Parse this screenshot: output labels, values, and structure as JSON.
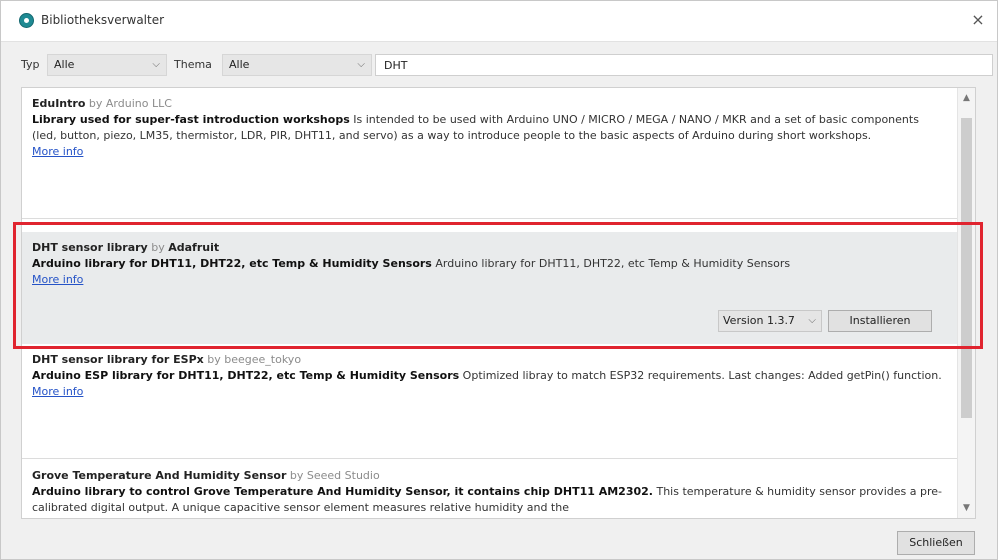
{
  "window": {
    "title": "Bibliotheksverwalter",
    "close_glyph": "×"
  },
  "filters": {
    "type_label": "Typ",
    "type_value": "Alle",
    "topic_label": "Thema",
    "topic_value": "Alle",
    "search_value": "DHT",
    "chevron": "⌵"
  },
  "libraries": [
    {
      "name": "EduIntro",
      "by": "by",
      "author": "Arduino LLC",
      "summary": "Library used for super-fast introduction workshops",
      "description": " Is intended to be used with Arduino UNO / MICRO / MEGA / NANO / MKR and a set of basic components (led, button, piezo, LM35, thermistor, LDR, PIR, DHT11, and servo) as a way to introduce people to the basic aspects of Arduino during short workshops.",
      "more_info": "More info"
    },
    {
      "name": "DHT sensor library",
      "by": "by",
      "author": "Adafruit",
      "summary": "Arduino library for DHT11, DHT22, etc Temp & Humidity Sensors",
      "description": " Arduino library for DHT11, DHT22, etc Temp & Humidity Sensors",
      "more_info": "More info",
      "version_label": "Version 1.3.7",
      "install_label": "Installieren"
    },
    {
      "name": "DHT sensor library for ESPx",
      "by": "by",
      "author": "beegee_tokyo",
      "summary": "Arduino ESP library for DHT11, DHT22, etc Temp & Humidity Sensors",
      "description": " Optimized libray to match ESP32 requirements. Last changes: Added getPin() function.",
      "more_info": "More info"
    },
    {
      "name": "Grove Temperature And Humidity Sensor",
      "by": "by",
      "author": "Seeed Studio",
      "summary": "Arduino library to control Grove Temperature And Humidity Sensor, it contains chip DHT11 AM2302.",
      "description": " This temperature & humidity sensor provides a pre-calibrated digital output. A unique capacitive sensor element measures relative humidity and the"
    }
  ],
  "scroll": {
    "up": "▲",
    "down": "▼"
  },
  "footer": {
    "close_label": "Schließen"
  },
  "colors": {
    "highlight": "#e0242f",
    "link": "#2553c7",
    "selected_bg": "#e9ebec"
  }
}
